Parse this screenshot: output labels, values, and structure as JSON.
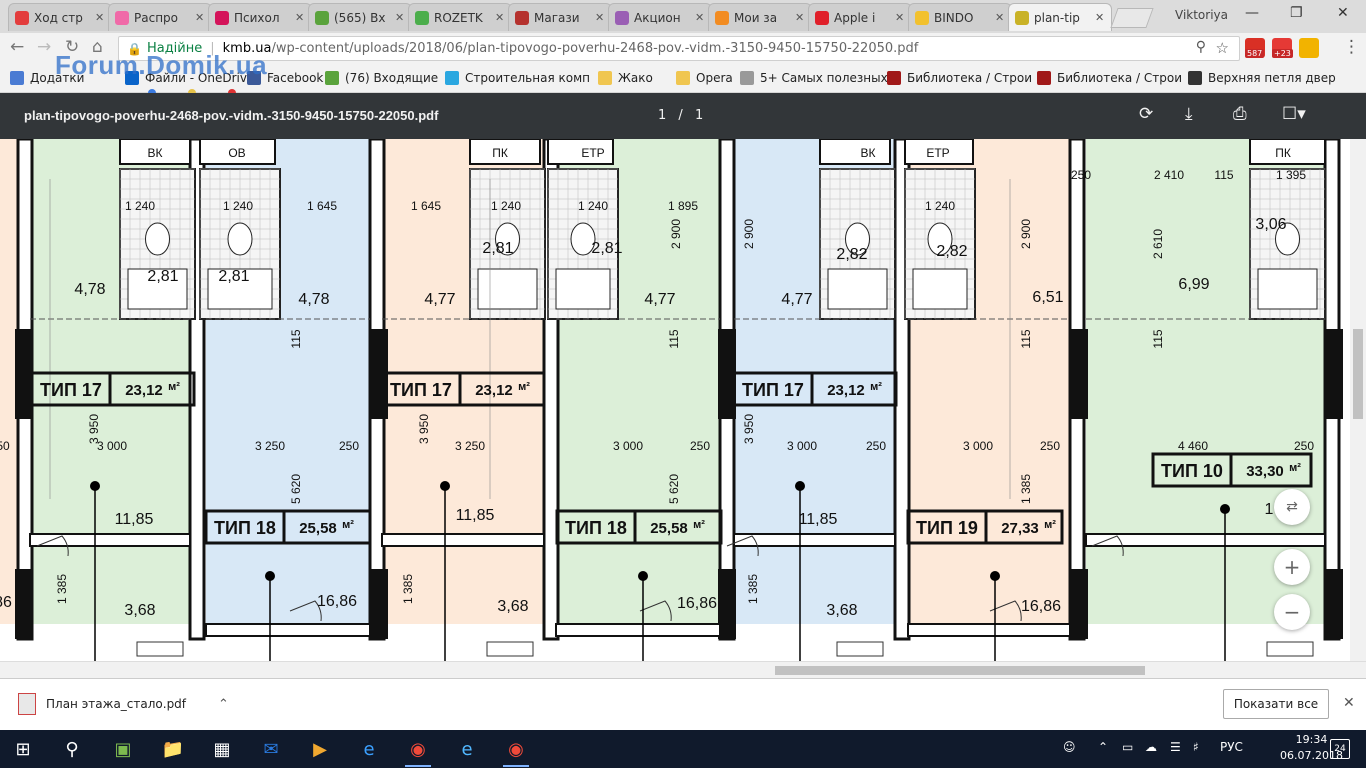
{
  "browser": {
    "tabs": [
      {
        "title": "Ход стр",
        "color": "#e33d3d"
      },
      {
        "title": "Распро",
        "color": "#f06aa8"
      },
      {
        "title": "Психол",
        "color": "#d4145a"
      },
      {
        "title": "(565) Вх",
        "color": "#5aa33c"
      },
      {
        "title": "ROZETK",
        "color": "#4cae4c"
      },
      {
        "title": "Магази",
        "color": "#b5322e"
      },
      {
        "title": "Акцион",
        "color": "#9a5fb4"
      },
      {
        "title": "Мои за",
        "color": "#f28c22"
      },
      {
        "title": "Apple i",
        "color": "#e0202a"
      },
      {
        "title": "BINDO",
        "color": "#f2c12e"
      },
      {
        "title": "plan-tip",
        "color": "#c9b227",
        "active": true
      }
    ],
    "profile_name": "Viktoriya",
    "address": {
      "security_label": "Надійне",
      "host": "kmb.ua",
      "path": "/wp-content/uploads/2018/06/plan-tipovogo-poverhu-2468-pov.-vidm.-3150-9450-15750-22050.pdf"
    },
    "extensions": [
      {
        "name": "gmail-icon",
        "badge": "587",
        "color": "#d93025"
      },
      {
        "name": "weather-icon",
        "badge": "+23",
        "color": "#e53935"
      },
      {
        "name": "cart-icon",
        "badge": "",
        "color": "#f2b300"
      }
    ],
    "bookmarks": [
      {
        "label": "Додатки",
        "icon": "apps-icon",
        "color": "#4a7bd3"
      },
      {
        "label": "Файли - OneDrive",
        "icon": "onedrive-icon",
        "color": "#0a64c9"
      },
      {
        "label": "Facebook",
        "icon": "facebook-icon",
        "color": "#3b5998"
      },
      {
        "label": "(76) Входящие",
        "icon": "mail-icon",
        "color": "#5aa33c"
      },
      {
        "label": "Строительная комп",
        "icon": "building-icon",
        "color": "#2aa7e0"
      },
      {
        "label": "Жако",
        "icon": "folder-icon",
        "color": "#f0c650"
      },
      {
        "label": "Opera",
        "icon": "folder-icon",
        "color": "#f0c650"
      },
      {
        "label": "5+ Самых полезных",
        "icon": "page-icon",
        "color": "#999999"
      },
      {
        "label": "Библиотека / Строи",
        "icon": "library-icon",
        "color": "#a01818"
      },
      {
        "label": "Библиотека / Строи",
        "icon": "library-icon",
        "color": "#a01818"
      },
      {
        "label": "Верхняя петля двер",
        "icon": "hinge-icon",
        "color": "#333333"
      }
    ],
    "watermark": "Forum.Domik.ua"
  },
  "pdf": {
    "title": "plan-tipovogo-poverhu-2468-pov.-vidm.-3150-9450-15750-22050.pdf",
    "current_page": "1",
    "page_separator": "/",
    "total_pages": "1",
    "plan": {
      "top_labels": [
        "ВК",
        "ОВ",
        "ПК",
        "ЕТР",
        "ВК",
        "ЕТР",
        "ПК"
      ],
      "dims_top": [
        "1 240",
        "1 240",
        "1 645",
        "1 645",
        "1 240",
        "1 240",
        "1 895",
        "1 240",
        "250",
        "2 410",
        "115",
        "1 395"
      ],
      "vertical_dims": [
        "2 900",
        "2 900",
        "2 900",
        "2 610",
        "115",
        "115",
        "115",
        "115",
        "3 950",
        "3 950",
        "3 950",
        "5 620",
        "5 620",
        "1 385",
        "1 385",
        "1 385",
        "1 385"
      ],
      "bath_areas": [
        "2,81",
        "2,81",
        "2,81",
        "2,81",
        "2,82",
        "2,82",
        "3,06"
      ],
      "hall_areas": [
        "4,78",
        "4,78",
        "4,77",
        "4,77",
        "4,77",
        "6,51",
        "6,99"
      ],
      "room_dims": [
        "3 000",
        "3 250",
        "250",
        "3 250",
        "3 000",
        "250",
        "3 000",
        "250",
        "3 000",
        "250",
        "4 460",
        "250",
        "50"
      ],
      "units": [
        {
          "type": "ТИП 17",
          "area": "23,12",
          "unit": "м²"
        },
        {
          "type": "ТИП 17",
          "area": "23,12",
          "unit": "м²"
        },
        {
          "type": "ТИП 17",
          "area": "23,12",
          "unit": "м²"
        },
        {
          "type": "ТИП 18",
          "area": "25,58",
          "unit": "м²"
        },
        {
          "type": "ТИП 18",
          "area": "25,58",
          "unit": "м²"
        },
        {
          "type": "ТИП 19",
          "area": "27,33",
          "unit": "м²"
        },
        {
          "type": "ТИП 10",
          "area": "33,30",
          "unit": "м²"
        }
      ],
      "room_areas": [
        "11,85",
        "11,85",
        "11,85",
        "16,86",
        "16,86",
        "16,86",
        "3,68",
        "3,68",
        "3,68",
        "86",
        "1"
      ]
    },
    "zoom_controls": [
      "fit-icon",
      "+",
      "−"
    ]
  },
  "downloads": {
    "file_name": "План этажа_стало.pdf",
    "show_all": "Показати все"
  },
  "taskbar": {
    "lang": "РУС",
    "time": "19:34",
    "date": "06.07.2018",
    "notifications": "24"
  }
}
